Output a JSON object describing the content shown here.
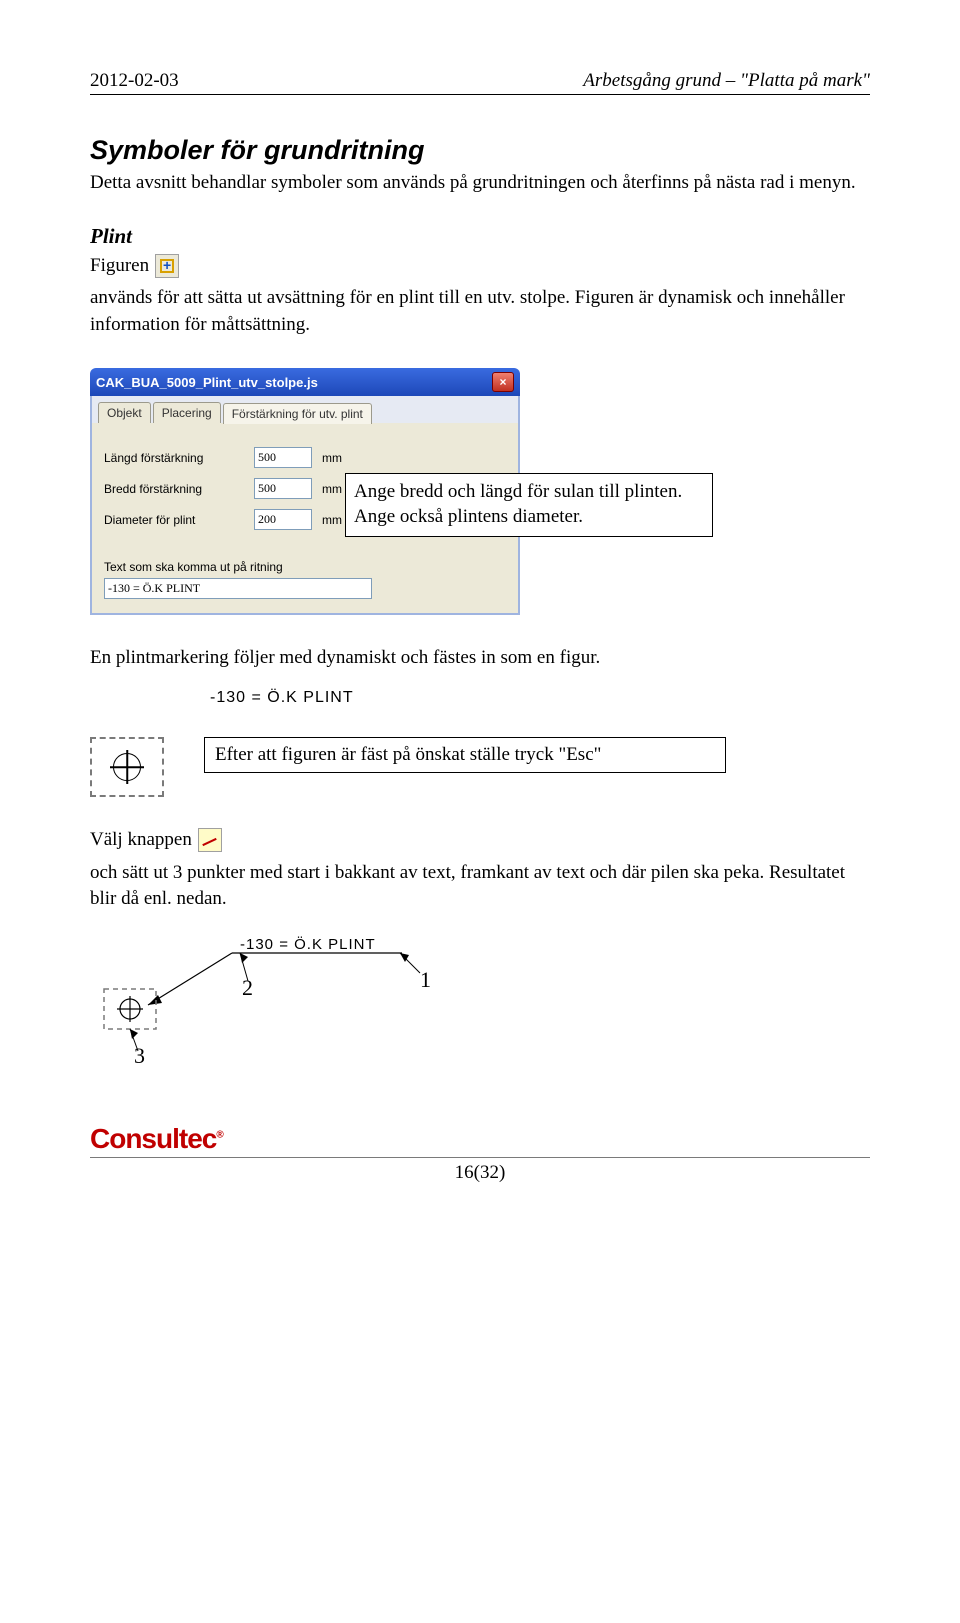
{
  "header": {
    "date": "2012-02-03",
    "doc_title": "Arbetsgång grund – \"Platta på mark\""
  },
  "h1": "Symboler för grundritning",
  "intro": "Detta avsnitt behandlar symboler som används på grundritningen och återfinns på nästa rad i menyn.",
  "section": {
    "title": "Plint",
    "line1a": "Figuren",
    "line1b": "används för att sätta ut avsättning för en plint till en utv. stolpe. Figuren är dynamisk och innehåller information för måttsättning."
  },
  "dialog": {
    "titlebar": "CAK_BUA_5009_Plint_utv_stolpe.js",
    "tabs": [
      "Objekt",
      "Placering",
      "Förstärkning för utv. plint"
    ],
    "rows": [
      {
        "label": "Längd förstärkning",
        "value": "500",
        "unit": "mm"
      },
      {
        "label": "Bredd förstärkning",
        "value": "500",
        "unit": "mm"
      },
      {
        "label": "Diameter för plint",
        "value": "200",
        "unit": "mm"
      }
    ],
    "textlabel": "Text som ska komma ut på ritning",
    "textvalue": "-130 = Ö.K PLINT"
  },
  "callout": {
    "l1": "Ange  bredd och längd för sulan till plinten.",
    "l2": "Ange också plintens diameter."
  },
  "after_dialog": "En plintmarkering följer med dynamiskt och fästes in som en figur.",
  "plintmark_text": "-130 = Ö.K PLINT",
  "esc_box": "Efter att figuren är fäst på önskat ställe tryck \"Esc\"",
  "leader": {
    "a": "Välj knappen",
    "b": "och sätt ut 3 punkter med start i bakkant av text, framkant av text och där pilen ska peka. Resultatet blir då enl. nedan."
  },
  "result_text": "-130 = Ö.K PLINT",
  "nums": {
    "n1": "1",
    "n2": "2",
    "n3": "3"
  },
  "footer": {
    "logo": "Consultec",
    "page": "16(32)"
  }
}
